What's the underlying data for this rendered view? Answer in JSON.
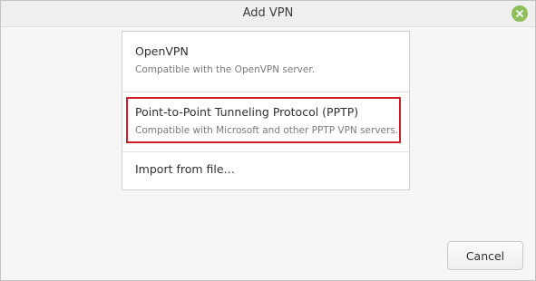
{
  "window": {
    "title": "Add VPN",
    "close_icon": "close-icon",
    "accent_color": "#8fbf5a"
  },
  "options": [
    {
      "title": "OpenVPN",
      "description": "Compatible with the OpenVPN server."
    },
    {
      "title": "Point-to-Point Tunneling Protocol (PPTP)",
      "description": "Compatible with Microsoft and other PPTP VPN servers.",
      "highlighted": true,
      "highlight_color": "#d11f2a"
    },
    {
      "title": "Import from file…"
    }
  ],
  "footer": {
    "cancel_label": "Cancel"
  }
}
